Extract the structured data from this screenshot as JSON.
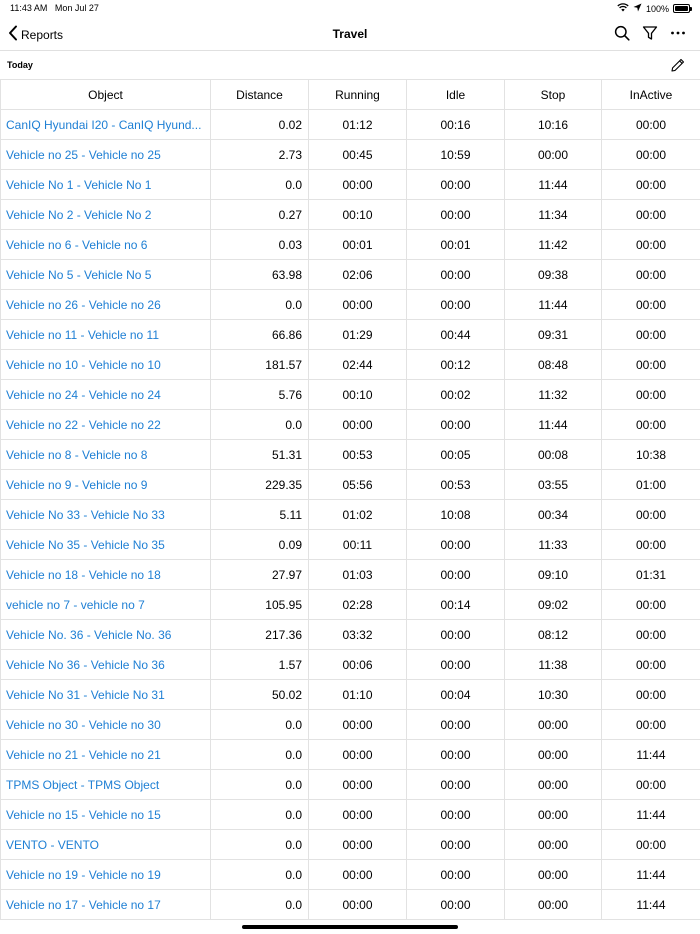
{
  "status_bar": {
    "time": "11:43 AM",
    "date": "Mon Jul 27",
    "battery": "100%"
  },
  "nav": {
    "back_label": "Reports",
    "title": "Travel"
  },
  "subbar": {
    "label": "Today"
  },
  "table": {
    "headers": [
      "Object",
      "Distance",
      "Running",
      "Idle",
      "Stop",
      "InActive"
    ],
    "rows": [
      [
        "CanIQ Hyundai I20 - CanIQ Hyund...",
        "0.02",
        "01:12",
        "00:16",
        "10:16",
        "00:00"
      ],
      [
        "Vehicle no 25 - Vehicle no 25",
        "2.73",
        "00:45",
        "10:59",
        "00:00",
        "00:00"
      ],
      [
        "Vehicle No 1 - Vehicle No 1",
        "0.0",
        "00:00",
        "00:00",
        "11:44",
        "00:00"
      ],
      [
        "Vehicle No 2 - Vehicle No 2",
        "0.27",
        "00:10",
        "00:00",
        "11:34",
        "00:00"
      ],
      [
        "Vehicle no 6 - Vehicle no 6",
        "0.03",
        "00:01",
        "00:01",
        "11:42",
        "00:00"
      ],
      [
        "Vehicle No 5 - Vehicle No 5",
        "63.98",
        "02:06",
        "00:00",
        "09:38",
        "00:00"
      ],
      [
        "Vehicle no 26 - Vehicle no 26",
        "0.0",
        "00:00",
        "00:00",
        "11:44",
        "00:00"
      ],
      [
        "Vehicle no 11 - Vehicle no 11",
        "66.86",
        "01:29",
        "00:44",
        "09:31",
        "00:00"
      ],
      [
        "Vehicle no 10 - Vehicle no 10",
        "181.57",
        "02:44",
        "00:12",
        "08:48",
        "00:00"
      ],
      [
        "Vehicle no 24 - Vehicle no 24",
        "5.76",
        "00:10",
        "00:02",
        "11:32",
        "00:00"
      ],
      [
        "Vehicle no 22 - Vehicle no 22",
        "0.0",
        "00:00",
        "00:00",
        "11:44",
        "00:00"
      ],
      [
        "Vehicle no 8 - Vehicle no 8",
        "51.31",
        "00:53",
        "00:05",
        "00:08",
        "10:38"
      ],
      [
        "Vehicle no 9 - Vehicle no 9",
        "229.35",
        "05:56",
        "00:53",
        "03:55",
        "01:00"
      ],
      [
        "Vehicle No 33 - Vehicle No 33",
        "5.11",
        "01:02",
        "10:08",
        "00:34",
        "00:00"
      ],
      [
        "Vehicle No 35 - Vehicle No 35",
        "0.09",
        "00:11",
        "00:00",
        "11:33",
        "00:00"
      ],
      [
        "Vehicle no 18 - Vehicle no 18",
        "27.97",
        "01:03",
        "00:00",
        "09:10",
        "01:31"
      ],
      [
        "vehicle no 7 - vehicle no 7",
        "105.95",
        "02:28",
        "00:14",
        "09:02",
        "00:00"
      ],
      [
        "Vehicle No. 36 - Vehicle No. 36",
        "217.36",
        "03:32",
        "00:00",
        "08:12",
        "00:00"
      ],
      [
        "Vehicle No 36 - Vehicle No 36",
        "1.57",
        "00:06",
        "00:00",
        "11:38",
        "00:00"
      ],
      [
        "Vehicle No 31 - Vehicle No 31",
        "50.02",
        "01:10",
        "00:04",
        "10:30",
        "00:00"
      ],
      [
        "Vehicle no 30 - Vehicle no 30",
        "0.0",
        "00:00",
        "00:00",
        "00:00",
        "00:00"
      ],
      [
        "Vehicle no 21 - Vehicle no 21",
        "0.0",
        "00:00",
        "00:00",
        "00:00",
        "11:44"
      ],
      [
        "TPMS Object - TPMS Object",
        "0.0",
        "00:00",
        "00:00",
        "00:00",
        "00:00"
      ],
      [
        "Vehicle no 15 - Vehicle no 15",
        "0.0",
        "00:00",
        "00:00",
        "00:00",
        "11:44"
      ],
      [
        "VENTO - VENTO",
        "0.0",
        "00:00",
        "00:00",
        "00:00",
        "00:00"
      ],
      [
        "Vehicle no 19 - Vehicle no 19",
        "0.0",
        "00:00",
        "00:00",
        "00:00",
        "11:44"
      ],
      [
        "Vehicle no 17 - Vehicle no 17",
        "0.0",
        "00:00",
        "00:00",
        "00:00",
        "11:44"
      ]
    ]
  },
  "colors": {
    "link": "#1e7fd4",
    "grid": "#e2e2e2",
    "text": "#000000"
  },
  "icons": [
    "chevron-left-icon",
    "search-icon",
    "filter-icon",
    "more-icon",
    "pencil-icon",
    "wifi-icon",
    "location-icon",
    "battery-icon"
  ]
}
